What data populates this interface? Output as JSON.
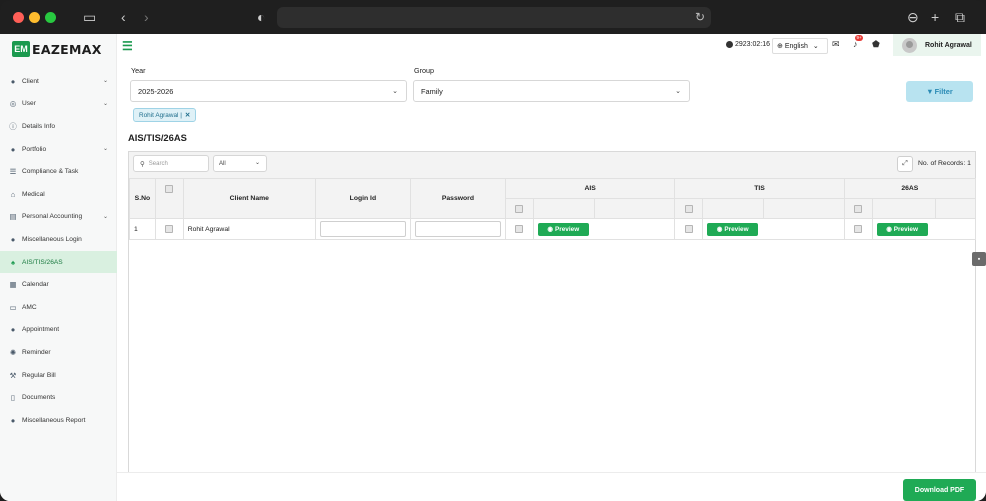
{
  "app": {
    "brand": "EAZEMAX",
    "brand_mark": "EM"
  },
  "sidebar": {
    "items": [
      {
        "label": "Client",
        "icon": "user-icon",
        "caret": true
      },
      {
        "label": "User",
        "icon": "user-circle-icon",
        "caret": true
      },
      {
        "label": "Details Info",
        "icon": "info-icon",
        "caret": false
      },
      {
        "label": "Portfolio",
        "icon": "user-icon",
        "caret": true
      },
      {
        "label": "Compliance & Task",
        "icon": "list-icon",
        "caret": false
      },
      {
        "label": "Medical",
        "icon": "home-icon",
        "caret": false
      },
      {
        "label": "Personal Accounting",
        "icon": "briefcase-icon",
        "caret": true
      },
      {
        "label": "Miscellaneous Login",
        "icon": "user-icon",
        "caret": false
      },
      {
        "label": "AIS/TIS/26AS",
        "icon": "bell-icon",
        "caret": false,
        "active": true
      },
      {
        "label": "Calendar",
        "icon": "calendar-icon",
        "caret": false
      },
      {
        "label": "AMC",
        "icon": "card-icon",
        "caret": false
      },
      {
        "label": "Appointment",
        "icon": "user-icon",
        "caret": false
      },
      {
        "label": "Reminder",
        "icon": "gear-icon",
        "caret": false
      },
      {
        "label": "Regular Bill",
        "icon": "hammer-icon",
        "caret": false
      },
      {
        "label": "Documents",
        "icon": "document-icon",
        "caret": false
      },
      {
        "label": "Miscellaneous Report",
        "icon": "user-icon",
        "caret": false
      }
    ]
  },
  "topbar": {
    "timer": "2923:02:16",
    "language": "English",
    "notification_badge": "9+",
    "user_name": "Rohit Agrawal"
  },
  "filters": {
    "year_label": "Year",
    "year_value": "2025-2026",
    "group_label": "Group",
    "group_value": "Family",
    "filter_button": "Filter",
    "chip": "Rohit Agrawal |"
  },
  "section_title": "AIS/TIS/26AS",
  "table": {
    "search_placeholder": "Search",
    "select_value": "All",
    "records": "No. of Records: 1",
    "headers": {
      "sno": "S.No",
      "client": "Client Name",
      "login": "Login Id",
      "password": "Password",
      "ais": "AIS",
      "tis": "TIS",
      "f26as": "26AS"
    },
    "rows": [
      {
        "sno": "1",
        "client": "Rohit Agrawal",
        "preview": "Preview"
      }
    ]
  },
  "footer": {
    "download_button": "Download PDF"
  },
  "colors": {
    "brand_green": "#1faa55",
    "active_nav_bg": "#d9f0e0",
    "filter_button_bg": "#b8e3f0"
  }
}
